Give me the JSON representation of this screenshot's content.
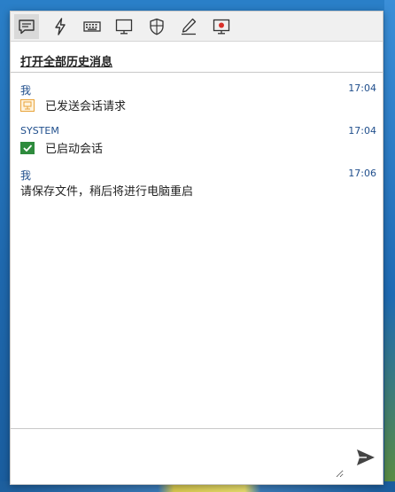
{
  "toolbar": {
    "buttons": [
      {
        "icon": "chat-icon",
        "active": true
      },
      {
        "icon": "lightning-icon",
        "active": false
      },
      {
        "icon": "keyboard-icon",
        "active": false
      },
      {
        "icon": "monitor-icon",
        "active": false
      },
      {
        "icon": "shield-icon",
        "active": false
      },
      {
        "icon": "pen-icon",
        "active": false
      },
      {
        "icon": "record-icon",
        "active": false
      }
    ]
  },
  "history": {
    "link_label": "打开全部历史消息"
  },
  "messages": [
    {
      "sender": "我",
      "time": "17:04",
      "text": "已发送会话请求",
      "icon": "session-request-icon",
      "icon_color": "#e8a33a"
    },
    {
      "sender": "SYSTEM",
      "time": "17:04",
      "text": "已启动会话",
      "icon": "session-started-icon",
      "icon_color": "#2e8b3d"
    },
    {
      "sender": "我",
      "time": "17:06",
      "text": "请保存文件，稍后将进行电脑重启",
      "icon": "",
      "icon_color": ""
    }
  ],
  "composer": {
    "value": "",
    "placeholder": ""
  },
  "colors": {
    "accent": "#1f4e8c",
    "record": "#d9312b"
  }
}
